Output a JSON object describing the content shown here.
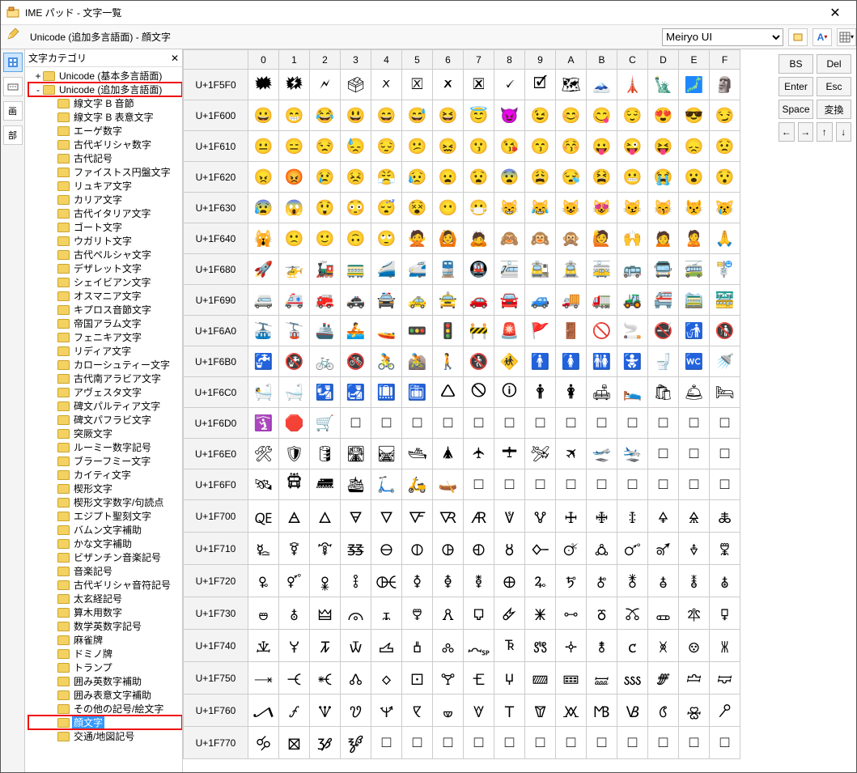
{
  "title": "IME パッド - 文字一覧",
  "category_path": "Unicode (追加多言語面) - 顔文字",
  "font_select": "Meiryo UI",
  "tree_header": "文字カテゴリ",
  "tree": [
    {
      "depth": 0,
      "label": "Unicode (基本多言語面)",
      "toggle": "+"
    },
    {
      "depth": 0,
      "label": "Unicode (追加多言語面)",
      "toggle": "-",
      "boxed": true
    },
    {
      "depth": 1,
      "label": "線文字 B 音節"
    },
    {
      "depth": 1,
      "label": "線文字 B 表意文字"
    },
    {
      "depth": 1,
      "label": "エーゲ数字"
    },
    {
      "depth": 1,
      "label": "古代ギリシャ数字"
    },
    {
      "depth": 1,
      "label": "古代記号"
    },
    {
      "depth": 1,
      "label": "ファイストス円盤文字"
    },
    {
      "depth": 1,
      "label": "リュキア文字"
    },
    {
      "depth": 1,
      "label": "カリア文字"
    },
    {
      "depth": 1,
      "label": "古代イタリア文字"
    },
    {
      "depth": 1,
      "label": "ゴート文字"
    },
    {
      "depth": 1,
      "label": "ウガリト文字"
    },
    {
      "depth": 1,
      "label": "古代ペルシャ文字"
    },
    {
      "depth": 1,
      "label": "デザレット文字"
    },
    {
      "depth": 1,
      "label": "シェイビアン文字"
    },
    {
      "depth": 1,
      "label": "オスマニア文字"
    },
    {
      "depth": 1,
      "label": "キプロス音節文字"
    },
    {
      "depth": 1,
      "label": "帝国アラム文字"
    },
    {
      "depth": 1,
      "label": "フェニキア文字"
    },
    {
      "depth": 1,
      "label": "リディア文字"
    },
    {
      "depth": 1,
      "label": "カローシュティー文字"
    },
    {
      "depth": 1,
      "label": "古代南アラビア文字"
    },
    {
      "depth": 1,
      "label": "アヴェスタ文字"
    },
    {
      "depth": 1,
      "label": "碑文パルティア文字"
    },
    {
      "depth": 1,
      "label": "碑文パフラビ文字"
    },
    {
      "depth": 1,
      "label": "突厥文字"
    },
    {
      "depth": 1,
      "label": "ルーミー数字記号"
    },
    {
      "depth": 1,
      "label": "ブラーフミー文字"
    },
    {
      "depth": 1,
      "label": "カイティ文字"
    },
    {
      "depth": 1,
      "label": "楔形文字"
    },
    {
      "depth": 1,
      "label": "楔形文字数字/句読点"
    },
    {
      "depth": 1,
      "label": "エジプト聖刻文字"
    },
    {
      "depth": 1,
      "label": "バムン文字補助"
    },
    {
      "depth": 1,
      "label": "かな文字補助"
    },
    {
      "depth": 1,
      "label": "ビザンチン音楽記号"
    },
    {
      "depth": 1,
      "label": "音楽記号"
    },
    {
      "depth": 1,
      "label": "古代ギリシャ音符記号"
    },
    {
      "depth": 1,
      "label": "太玄経記号"
    },
    {
      "depth": 1,
      "label": "算木用数字"
    },
    {
      "depth": 1,
      "label": "数学英数字記号"
    },
    {
      "depth": 1,
      "label": "麻雀牌"
    },
    {
      "depth": 1,
      "label": "ドミノ牌"
    },
    {
      "depth": 1,
      "label": "トランプ"
    },
    {
      "depth": 1,
      "label": "囲み英数字補助"
    },
    {
      "depth": 1,
      "label": "囲み表意文字補助"
    },
    {
      "depth": 1,
      "label": "その他の記号/絵文字"
    },
    {
      "depth": 1,
      "label": "顔文字",
      "selected": true,
      "boxed": true
    },
    {
      "depth": 1,
      "label": "交通/地図記号"
    }
  ],
  "columns": [
    "0",
    "1",
    "2",
    "3",
    "4",
    "5",
    "6",
    "7",
    "8",
    "9",
    "A",
    "B",
    "C",
    "D",
    "E",
    "F"
  ],
  "rows": [
    {
      "head": "U+1F5F0",
      "cells": [
        "🗰",
        "🗱",
        "🗲",
        "🗳",
        "🗴",
        "🗵",
        "🗶",
        "🗷",
        "🗸",
        "🗹",
        "🗺",
        "🗻",
        "🗼",
        "🗽",
        "🗾",
        "🗿"
      ]
    },
    {
      "head": "U+1F600",
      "cells": [
        "😀",
        "😁",
        "😂",
        "😃",
        "😄",
        "😅",
        "😆",
        "😇",
        "😈",
        "😉",
        "😊",
        "😋",
        "😌",
        "😍",
        "😎",
        "😏"
      ]
    },
    {
      "head": "U+1F610",
      "cells": [
        "😐",
        "😑",
        "😒",
        "😓",
        "😔",
        "😕",
        "😖",
        "😗",
        "😘",
        "😙",
        "😚",
        "😛",
        "😜",
        "😝",
        "😞",
        "😟"
      ]
    },
    {
      "head": "U+1F620",
      "cells": [
        "😠",
        "😡",
        "😢",
        "😣",
        "😤",
        "😥",
        "😦",
        "😧",
        "😨",
        "😩",
        "😪",
        "😫",
        "😬",
        "😭",
        "😮",
        "😯"
      ]
    },
    {
      "head": "U+1F630",
      "cells": [
        "😰",
        "😱",
        "😲",
        "😳",
        "😴",
        "😵",
        "😶",
        "😷",
        "😸",
        "😹",
        "😺",
        "😻",
        "😼",
        "😽",
        "😾",
        "😿"
      ]
    },
    {
      "head": "U+1F640",
      "cells": [
        "🙀",
        "🙁",
        "🙂",
        "🙃",
        "🙄",
        "🙅",
        "🙆",
        "🙇",
        "🙈",
        "🙉",
        "🙊",
        "🙋",
        "🙌",
        "🙍",
        "🙎",
        "🙏"
      ]
    },
    {
      "head": "U+1F680",
      "cells": [
        "🚀",
        "🚁",
        "🚂",
        "🚃",
        "🚄",
        "🚅",
        "🚆",
        "🚇",
        "🚈",
        "🚉",
        "🚊",
        "🚋",
        "🚌",
        "🚍",
        "🚎",
        "🚏"
      ]
    },
    {
      "head": "U+1F690",
      "cells": [
        "🚐",
        "🚑",
        "🚒",
        "🚓",
        "🚔",
        "🚕",
        "🚖",
        "🚗",
        "🚘",
        "🚙",
        "🚚",
        "🚛",
        "🚜",
        "🚝",
        "🚞",
        "🚟"
      ]
    },
    {
      "head": "U+1F6A0",
      "cells": [
        "🚠",
        "🚡",
        "🚢",
        "🚣",
        "🚤",
        "🚥",
        "🚦",
        "🚧",
        "🚨",
        "🚩",
        "🚪",
        "🚫",
        "🚬",
        "🚭",
        "🚮",
        "🚯"
      ]
    },
    {
      "head": "U+1F6B0",
      "cells": [
        "🚰",
        "🚱",
        "🚲",
        "🚳",
        "🚴",
        "🚵",
        "🚶",
        "🚷",
        "🚸",
        "🚹",
        "🚺",
        "🚻",
        "🚼",
        "🚽",
        "🚾",
        "🚿"
      ]
    },
    {
      "head": "U+1F6C0",
      "cells": [
        "🛀",
        "🛁",
        "🛂",
        "🛃",
        "🛄",
        "🛅",
        "🛆",
        "🛇",
        "🛈",
        "🛉",
        "🛊",
        "🛋",
        "🛌",
        "🛍",
        "🛎",
        "🛏"
      ]
    },
    {
      "head": "U+1F6D0",
      "cells": [
        "🛐",
        "🛑",
        "🛒",
        "□",
        "□",
        "□",
        "□",
        "□",
        "□",
        "□",
        "□",
        "□",
        "□",
        "□",
        "□",
        "□"
      ]
    },
    {
      "head": "U+1F6E0",
      "cells": [
        "🛠",
        "🛡",
        "🛢",
        "🛣",
        "🛤",
        "🛥",
        "🛦",
        "🛧",
        "🛨",
        "🛩",
        "🛪",
        "🛫",
        "🛬",
        "□",
        "□",
        "□"
      ]
    },
    {
      "head": "U+1F6F0",
      "cells": [
        "🛰",
        "🛱",
        "🛲",
        "🛳",
        "🛴",
        "🛵",
        "🛶",
        "□",
        "□",
        "□",
        "□",
        "□",
        "□",
        "□",
        "□",
        "□"
      ]
    },
    {
      "head": "U+1F700",
      "cells": [
        "🜀",
        "🜁",
        "🜂",
        "🜃",
        "🜄",
        "🜅",
        "🜆",
        "🜇",
        "🜈",
        "🜉",
        "🜊",
        "🜋",
        "🜌",
        "🜍",
        "🜎",
        "🜏"
      ]
    },
    {
      "head": "U+1F710",
      "cells": [
        "🜐",
        "🜑",
        "🜒",
        "🜓",
        "🜔",
        "🜕",
        "🜖",
        "🜗",
        "🜘",
        "🜙",
        "🜚",
        "🜛",
        "🜜",
        "🜝",
        "🜞",
        "🜟"
      ]
    },
    {
      "head": "U+1F720",
      "cells": [
        "🜠",
        "🜡",
        "🜢",
        "🜣",
        "🜤",
        "🜥",
        "🜦",
        "🜧",
        "🜨",
        "🜩",
        "🜪",
        "🜫",
        "🜬",
        "🜭",
        "🜮",
        "🜯"
      ]
    },
    {
      "head": "U+1F730",
      "cells": [
        "🜰",
        "🜱",
        "🜲",
        "🜳",
        "🜴",
        "🜵",
        "🜶",
        "🜷",
        "🜸",
        "🜹",
        "🜺",
        "🜻",
        "🜼",
        "🜽",
        "🜾",
        "🜿"
      ]
    },
    {
      "head": "U+1F740",
      "cells": [
        "🝀",
        "🝁",
        "🝂",
        "🝃",
        "🝄",
        "🝅",
        "🝆",
        "🝇",
        "🝈",
        "🝉",
        "🝊",
        "🝋",
        "🝌",
        "🝍",
        "🝎",
        "🝏"
      ]
    },
    {
      "head": "U+1F750",
      "cells": [
        "🝐",
        "🝑",
        "🝒",
        "🝓",
        "🝔",
        "🝕",
        "🝖",
        "🝗",
        "🝘",
        "🝙",
        "🝚",
        "🝛",
        "🝜",
        "🝝",
        "🝞",
        "🝟"
      ]
    },
    {
      "head": "U+1F760",
      "cells": [
        "🝠",
        "🝡",
        "🝢",
        "🝣",
        "🝤",
        "🝥",
        "🝦",
        "🝧",
        "🝨",
        "🝩",
        "🝪",
        "🝫",
        "🝬",
        "🝭",
        "🝮",
        "🝯"
      ]
    },
    {
      "head": "U+1F770",
      "cells": [
        "🝰",
        "🝱",
        "🝲",
        "🝳",
        "□",
        "□",
        "□",
        "□",
        "□",
        "□",
        "□",
        "□",
        "□",
        "□",
        "□",
        "□"
      ]
    }
  ],
  "buttons": {
    "bs": "BS",
    "del": "Del",
    "enter": "Enter",
    "esc": "Esc",
    "space": "Space",
    "henkan": "変換",
    "left": "←",
    "right": "→",
    "up": "↑",
    "down": "↓"
  }
}
